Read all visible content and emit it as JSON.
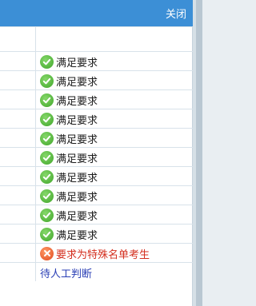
{
  "dialog": {
    "close_label": "关闭"
  },
  "results": [
    {
      "status": "ok",
      "text": "满足要求"
    },
    {
      "status": "ok",
      "text": "满足要求"
    },
    {
      "status": "ok",
      "text": "满足要求"
    },
    {
      "status": "ok",
      "text": "满足要求"
    },
    {
      "status": "ok",
      "text": "满足要求"
    },
    {
      "status": "ok",
      "text": "满足要求"
    },
    {
      "status": "ok",
      "text": "满足要求"
    },
    {
      "status": "ok",
      "text": "满足要求"
    },
    {
      "status": "ok",
      "text": "满足要求"
    },
    {
      "status": "ok",
      "text": "满足要求"
    },
    {
      "status": "error",
      "text": "要求为特殊名单考生"
    },
    {
      "status": "pending",
      "text": "待人工判断"
    }
  ],
  "colors": {
    "titlebar": "#3c8fd6",
    "ok_icon": "#3fa52a",
    "error_icon": "#e0491f",
    "error_text": "#d42f1f",
    "pending_text": "#2a3fb5"
  },
  "icons": {
    "ok": "check-circle-icon",
    "error": "x-circle-icon"
  }
}
